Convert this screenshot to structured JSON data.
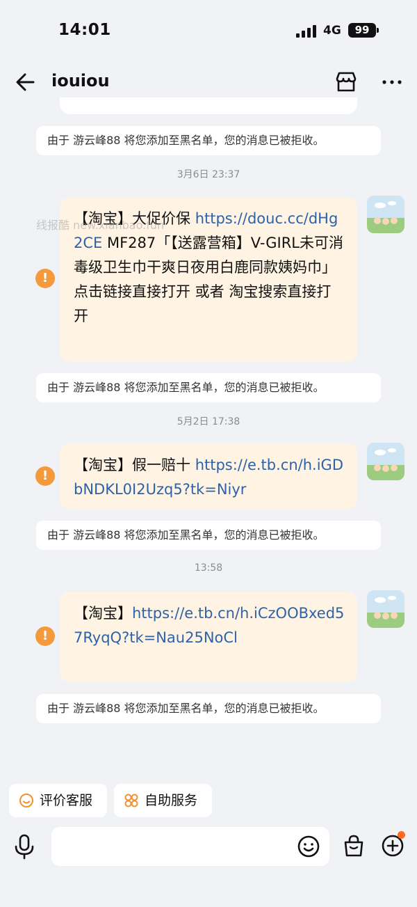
{
  "status_bar": {
    "time": "14:01",
    "network": "4G",
    "battery": "99"
  },
  "nav": {
    "title": "iouiou",
    "back_icon": "arrow-left-icon",
    "shop_icon": "storefront-icon",
    "more_icon": "ellipsis-icon"
  },
  "notice_text": "由于 游云峰88 将您添加至黑名单，您的消息已被拒收。",
  "watermark": "线报酷 new.xianbao.fun",
  "messages": [
    {
      "timestamp": "3月6日 23:37",
      "prefix": "【淘宝】大促价保 ",
      "link": "https://douc.cc/dHg2CE",
      "suffix": " MF287「【送露营箱】V-GIRL未可消毒级卫生巾干爽日夜用白鹿同款姨妈巾」",
      "line2": "点击链接直接打开 或者 淘宝搜索直接打开",
      "notice": "由于 游云峰88 将您添加至黑名单，您的消息已被拒收。"
    },
    {
      "timestamp": "5月2日 17:38",
      "prefix": "【淘宝】假一赔十 ",
      "link": "https://e.tb.cn/h.iGDbNDKL0I2Uzq5?tk=Niyr",
      "notice": "由于 游云峰88 将您添加至黑名单，您的消息已被拒收。"
    },
    {
      "timestamp": "13:58",
      "prefix": "【淘宝】",
      "link": "https://e.tb.cn/h.iCzOOBxed57RyqQ?tk=Nau25NoCl",
      "notice": "由于 游云峰88 将您添加至黑名单，您的消息已被拒收。"
    }
  ],
  "quick_actions": [
    {
      "label": "评价客服",
      "icon": "smile-icon"
    },
    {
      "label": "自助服务",
      "icon": "grid-flower-icon"
    }
  ],
  "input": {
    "placeholder": "",
    "value": ""
  },
  "colors": {
    "accent": "#f59a3c",
    "link": "#2d62a8",
    "bubble": "#fff4e3",
    "dot": "#ff6a1f"
  }
}
